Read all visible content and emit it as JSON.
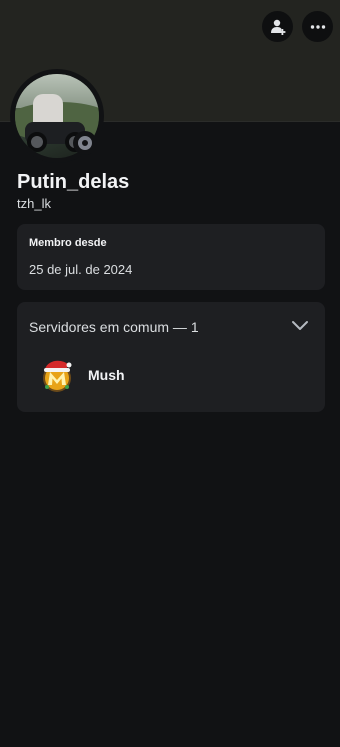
{
  "profile": {
    "display_name": "Putin_delas",
    "username": "tzh_lk",
    "status": "offline"
  },
  "member_since": {
    "label": "Membro desde",
    "date": "25 de jul. de 2024"
  },
  "mutual_servers": {
    "title": "Servidores em comum — 1",
    "items": [
      {
        "name": "Mush",
        "icon": "mush-server-icon"
      }
    ]
  },
  "actions": {
    "add_friend_icon": "add-friend-icon",
    "more_icon": "more-options-icon"
  },
  "colors": {
    "background": "#111214",
    "card": "#1e1f22",
    "banner": "#232420",
    "offline": "#80848e"
  }
}
